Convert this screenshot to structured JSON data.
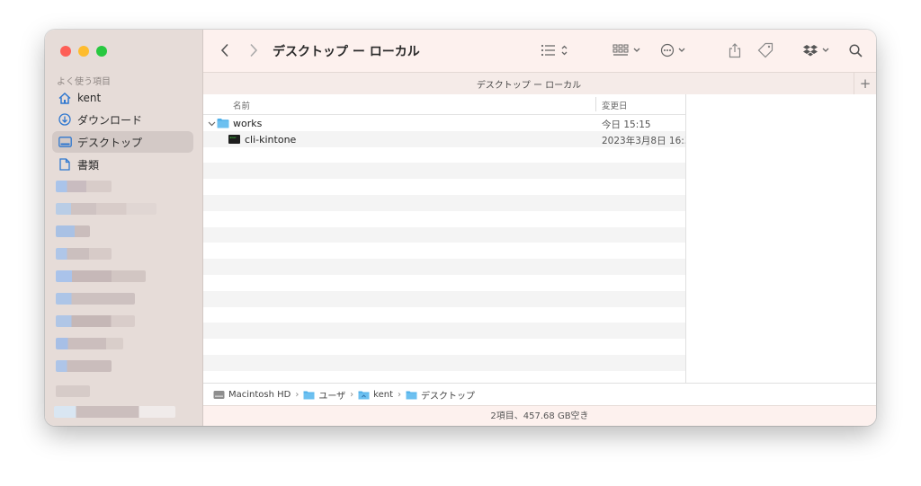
{
  "window": {
    "title": "デスクトップ ー ローカル",
    "tab_title": "デスクトップ ー ローカル",
    "tab_add": "+"
  },
  "sidebar": {
    "heading": "よく使う項目",
    "items": [
      {
        "label": "kent",
        "icon": "home-icon"
      },
      {
        "label": "ダウンロード",
        "icon": "download-icon"
      },
      {
        "label": "デスクトップ",
        "icon": "desktop-icon",
        "selected": true
      },
      {
        "label": "書類",
        "icon": "document-icon"
      }
    ]
  },
  "columns": {
    "name": "名前",
    "modified": "変更日"
  },
  "files": [
    {
      "name": "works",
      "date": "今日 15:15",
      "kind": "folder",
      "expanded": true
    },
    {
      "name": "cli-kintone",
      "date": "2023年3月8日 16:3",
      "kind": "executable"
    }
  ],
  "path": [
    {
      "label": "Macintosh HD",
      "icon": "hard-drive-icon"
    },
    {
      "label": "ユーザ",
      "icon": "folder-icon"
    },
    {
      "label": "kent",
      "icon": "home-folder-icon"
    },
    {
      "label": "デスクトップ",
      "icon": "folder-icon"
    }
  ],
  "status": "2項目、457.68 GB空き",
  "colors": {
    "sidebar_bg": "#e6dcd8",
    "toolbar_bg": "#fdf1ee",
    "selected_bg": "#d3c9c6",
    "folder_blue": "#4fb0ea"
  }
}
